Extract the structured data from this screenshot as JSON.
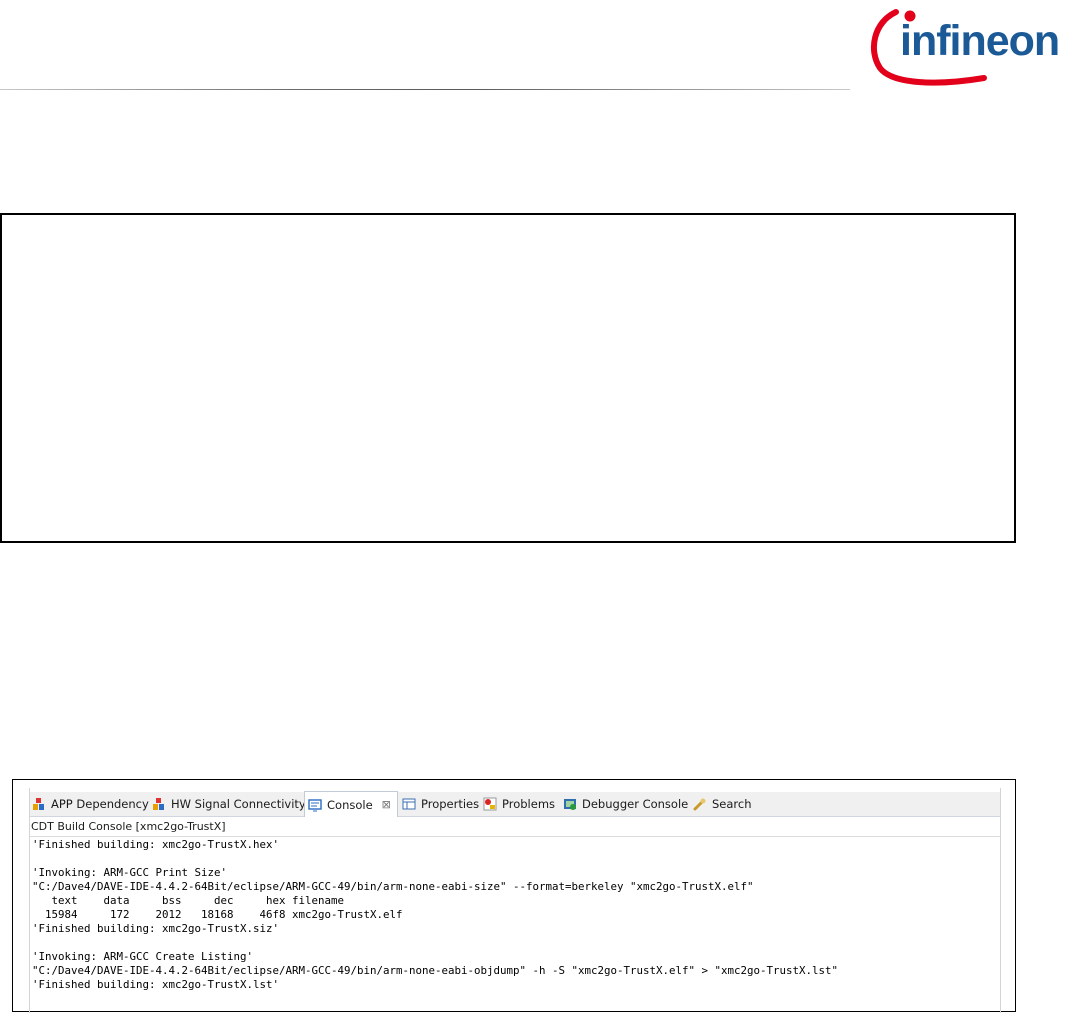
{
  "header": {
    "logo_text": "infineon",
    "brand_color_blue": "#1b5a96",
    "brand_color_red": "#e2001a"
  },
  "console_screenshot": {
    "tabs": [
      {
        "label": "APP Dependency",
        "icon": "app-dependency-icon",
        "active": false
      },
      {
        "label": "HW Signal Connectivity",
        "icon": "hw-signal-icon",
        "active": false
      },
      {
        "label": "Console",
        "icon": "console-icon",
        "active": true,
        "close": "⊠"
      },
      {
        "label": "Properties",
        "icon": "properties-icon",
        "active": false
      },
      {
        "label": "Problems",
        "icon": "problems-icon",
        "active": false
      },
      {
        "label": "Debugger Console",
        "icon": "debugger-console-icon",
        "active": false
      },
      {
        "label": "Search",
        "icon": "search-icon",
        "active": false
      }
    ],
    "console_title": "CDT Build Console [xmc2go-TrustX]",
    "lines": [
      "'Finished building: xmc2go-TrustX.hex'",
      "",
      "'Invoking: ARM-GCC Print Size'",
      "\"C:/Dave4/DAVE-IDE-4.4.2-64Bit/eclipse/ARM-GCC-49/bin/arm-none-eabi-size\" --format=berkeley \"xmc2go-TrustX.elf\"",
      "   text    data     bss     dec     hex filename",
      "  15984     172    2012   18168    46f8 xmc2go-TrustX.elf",
      "'Finished building: xmc2go-TrustX.siz'",
      "",
      "'Invoking: ARM-GCC Create Listing'",
      "\"C:/Dave4/DAVE-IDE-4.4.2-64Bit/eclipse/ARM-GCC-49/bin/arm-none-eabi-objdump\" -h -S \"xmc2go-TrustX.elf\" > \"xmc2go-TrustX.lst\"",
      "'Finished building: xmc2go-TrustX.lst'"
    ]
  }
}
